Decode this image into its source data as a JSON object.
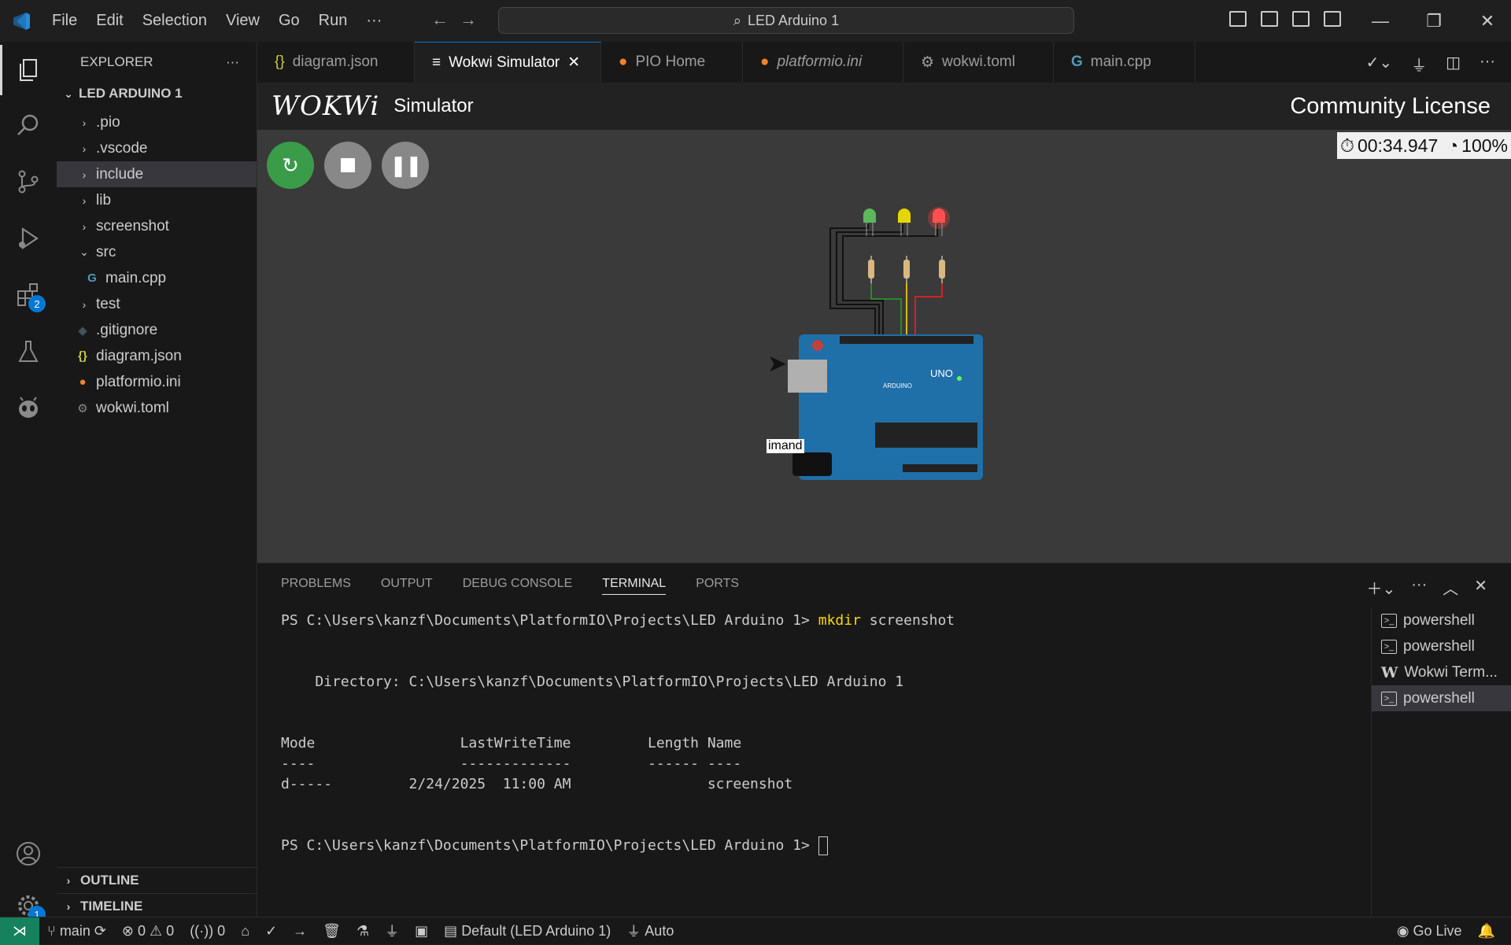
{
  "title_bar": {
    "menu": [
      "File",
      "Edit",
      "Selection",
      "View",
      "Go",
      "Run",
      "···"
    ],
    "search": "LED Arduino 1"
  },
  "activity_bar": {
    "extensions_badge": "2",
    "settings_badge": "1"
  },
  "explorer": {
    "header": "EXPLORER",
    "more": "···",
    "project": "LED ARDUINO 1",
    "items": [
      {
        "label": ".pio",
        "type": "folder"
      },
      {
        "label": ".vscode",
        "type": "folder"
      },
      {
        "label": "include",
        "type": "folder"
      },
      {
        "label": "lib",
        "type": "folder"
      },
      {
        "label": "screenshot",
        "type": "folder"
      },
      {
        "label": "src",
        "type": "folder-open"
      },
      {
        "label": "main.cpp",
        "type": "cpp"
      },
      {
        "label": "test",
        "type": "folder"
      },
      {
        "label": ".gitignore",
        "type": "git"
      },
      {
        "label": "diagram.json",
        "type": "json"
      },
      {
        "label": "platformio.ini",
        "type": "pio"
      },
      {
        "label": "wokwi.toml",
        "type": "gear"
      }
    ],
    "outline": "OUTLINE",
    "timeline": "TIMELINE"
  },
  "tabs": [
    {
      "label": "diagram.json",
      "icon": "{}"
    },
    {
      "label": "Wokwi Simulator",
      "icon": "≡",
      "close": "✕"
    },
    {
      "label": "PIO Home",
      "icon": "🐜"
    },
    {
      "label": "platformio.ini",
      "icon": "🐜"
    },
    {
      "label": "wokwi.toml",
      "icon": "⚙"
    },
    {
      "label": "main.cpp",
      "icon": "G"
    }
  ],
  "wokwi": {
    "logo": "WOKWi",
    "simulator": "Simulator",
    "license": "Community License",
    "timer": "00:34.947",
    "speed": "100%",
    "tooltip": "imand"
  },
  "panel": {
    "tabs": [
      "PROBLEMS",
      "OUTPUT",
      "DEBUG CONSOLE",
      "TERMINAL",
      "PORTS"
    ],
    "terminal": {
      "prompt": "PS C:\\Users\\kanzf\\Documents\\PlatformIO\\Projects\\LED Arduino 1> ",
      "cmd1": "mkdir",
      "cmd1_arg": " screenshot",
      "directory": "    Directory: C:\\Users\\kanzf\\Documents\\PlatformIO\\Projects\\LED Arduino 1",
      "header": "Mode                 LastWriteTime         Length Name",
      "dashes": "----                 -------------         ------ ----",
      "row": "d-----         2/24/2025  11:00 AM                screenshot"
    },
    "terminals": [
      {
        "label": "powershell",
        "icon": ">_"
      },
      {
        "label": "powershell",
        "icon": ">_"
      },
      {
        "label": "Wokwi Term...",
        "icon": "W"
      },
      {
        "label": "powershell",
        "icon": ">_"
      }
    ]
  },
  "status": {
    "branch": "main",
    "errors": "0",
    "warnings": "0",
    "ports": "0",
    "env": "Default (LED Arduino 1)",
    "auto": "Auto",
    "golive": "Go Live"
  }
}
